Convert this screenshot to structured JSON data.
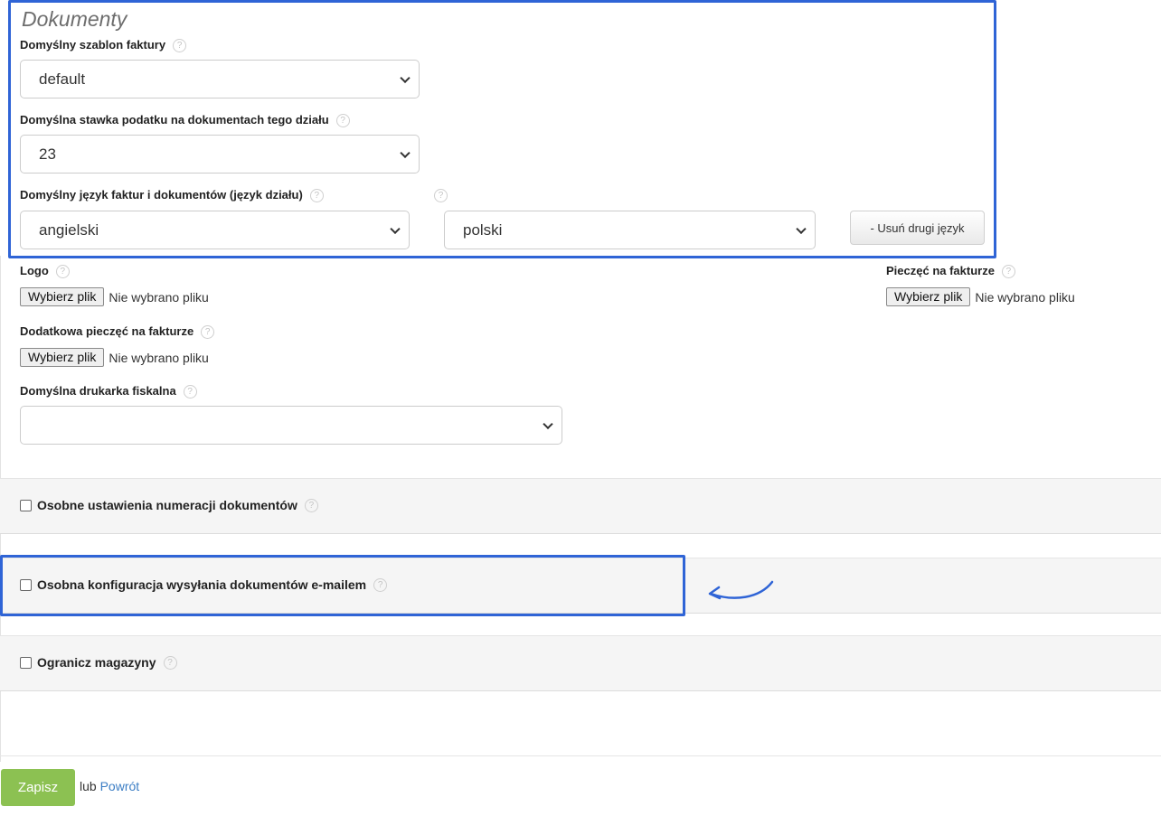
{
  "section": {
    "title": "Dokumenty"
  },
  "invoice_template": {
    "label": "Domyślny szablon faktury",
    "value": "default"
  },
  "tax_rate": {
    "label": "Domyślna stawka podatku na dokumentach tego działu",
    "value": "23"
  },
  "language": {
    "label": "Domyślny język faktur i dokumentów (język działu)",
    "primary_value": "angielski",
    "secondary_value": "polski",
    "remove_second_label": "- Usuń drugi język"
  },
  "logo": {
    "label": "Logo",
    "button": "Wybierz plik",
    "status": "Nie wybrano pliku"
  },
  "invoice_stamp": {
    "label": "Pieczęć na fakturze",
    "button": "Wybierz plik",
    "status": "Nie wybrano pliku"
  },
  "extra_stamp": {
    "label": "Dodatkowa pieczęć na fakturze",
    "button": "Wybierz plik",
    "status": "Nie wybrano pliku"
  },
  "fiscal_printer": {
    "label": "Domyślna drukarka fiskalna",
    "value": ""
  },
  "panels": {
    "numbering": {
      "label": "Osobne ustawienia numeracji dokumentów",
      "checked": false
    },
    "email_config": {
      "label": "Osobna konfiguracja wysyłania dokumentów e-mailem",
      "checked": false
    },
    "warehouses": {
      "label": "Ogranicz magazyny",
      "checked": false
    }
  },
  "help_glyph": "?",
  "footer": {
    "save_label": "Zapisz",
    "or_text": "lub",
    "back_label": "Powrót"
  },
  "colors": {
    "accent_highlight": "#2f64d6",
    "save_green": "#8cc152",
    "link_blue": "#3b7dc4"
  },
  "icons": [
    "help-icon",
    "chevron-down-icon",
    "checkbox",
    "curved-arrow-icon"
  ]
}
